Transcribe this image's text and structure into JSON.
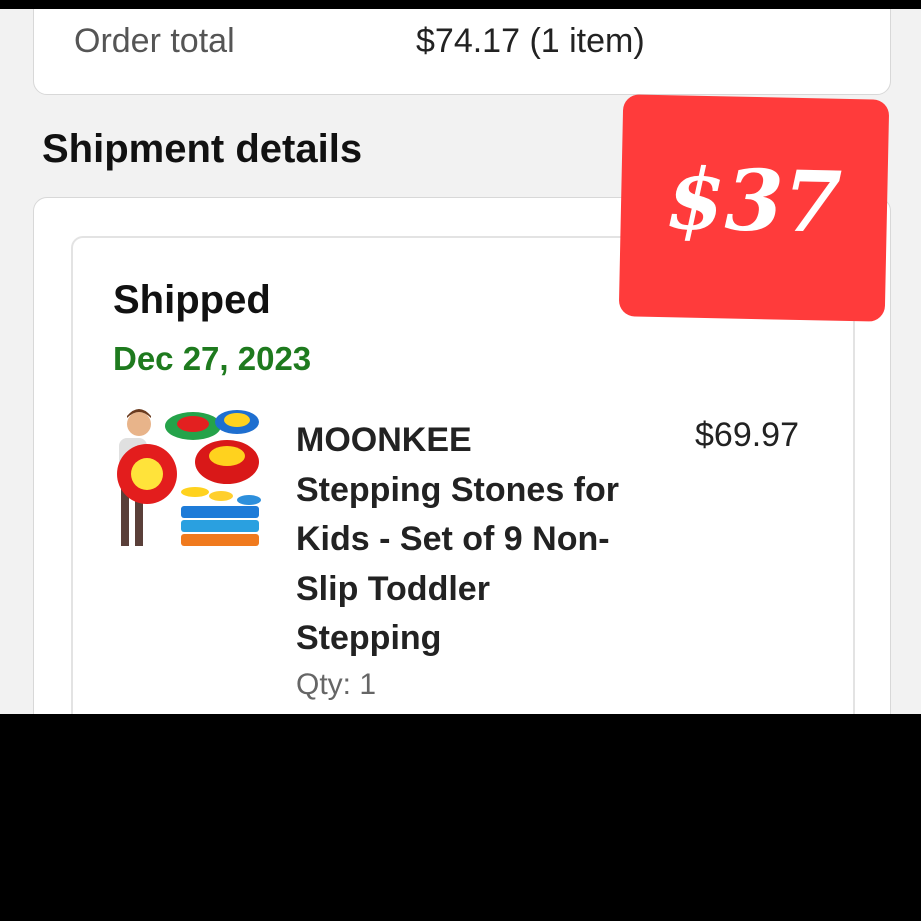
{
  "order_summary": {
    "total_label": "Order total",
    "total_value": "$74.17 (1 item)"
  },
  "shipment": {
    "section_title": "Shipment details",
    "status": "Shipped",
    "date": "Dec 27, 2023",
    "item": {
      "title": "MOONKEE Stepping Stones for Kids - Set of 9 Non-Slip Toddler Stepping",
      "price": "$69.97",
      "qty": "Qty: 1",
      "image_icon": "stepping-stones-product-image"
    }
  },
  "overlay": {
    "price_tag": "$37",
    "tag_color": "#ff3b3b"
  },
  "colors": {
    "status_date": "#1e7a1e",
    "card_bg": "#ffffff",
    "page_bg": "#f2f2f2"
  }
}
